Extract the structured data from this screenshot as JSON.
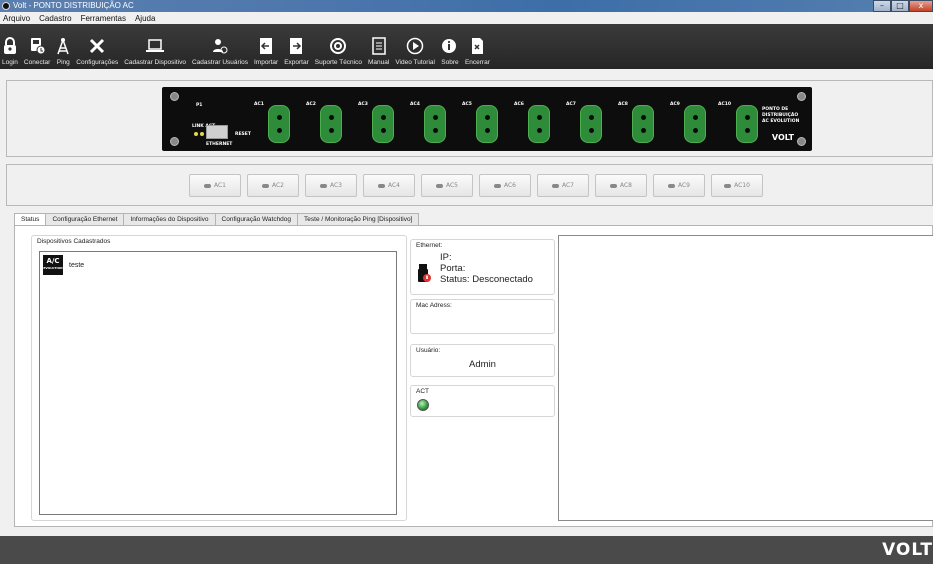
{
  "window": {
    "title": "Volt - PONTO DISTRIBUIÇÃO AC",
    "btn_min": "–",
    "btn_max": "□",
    "btn_close": "x"
  },
  "menu": [
    "Arquivo",
    "Cadastro",
    "Ferramentas",
    "Ajuda"
  ],
  "toolbar": [
    {
      "label": "Login",
      "icon": "lock-icon"
    },
    {
      "label": "Conectar",
      "icon": "connect-icon"
    },
    {
      "label": "Ping",
      "icon": "antenna-icon"
    },
    {
      "label": "Configurações",
      "icon": "tools-icon"
    },
    {
      "label": "Cadastrar Dispositivo",
      "icon": "laptop-icon"
    },
    {
      "label": "Cadastrar Usuários",
      "icon": "add-user-icon"
    },
    {
      "label": "Importar",
      "icon": "import-icon"
    },
    {
      "label": "Exportar",
      "icon": "export-icon"
    },
    {
      "label": "Suporte Técnico",
      "icon": "support-icon"
    },
    {
      "label": "Manual",
      "icon": "manual-icon"
    },
    {
      "label": "Video Tutorial",
      "icon": "play-icon"
    },
    {
      "label": "Sobre",
      "icon": "info-icon"
    },
    {
      "label": "Encerrar",
      "icon": "exit-icon"
    }
  ],
  "board": {
    "port_labels": [
      "AC1",
      "AC2",
      "AC3",
      "AC4",
      "AC5",
      "AC6",
      "AC7",
      "AC8",
      "AC9",
      "AC10"
    ],
    "p1_label": "P1",
    "link_label": "LINK ACT",
    "reset_label": "RESET",
    "ethernet_label": "ETHERNET",
    "brand_lines": [
      "PONTO DE",
      "DISTRIBUIÇÃO",
      "AC EVOLUTION"
    ],
    "logo": "VOLT"
  },
  "ac_buttons": [
    "AC1",
    "AC2",
    "AC3",
    "AC4",
    "AC5",
    "AC6",
    "AC7",
    "AC8",
    "AC9",
    "AC10"
  ],
  "tabs": [
    "Status",
    "Configuração Ethernet",
    "Informações do Dispositivo",
    "Configuração Watchdog",
    "Teste / Monitoração Ping [Dispositivo]"
  ],
  "status": {
    "devices_title": "Dispositivos Cadastrados",
    "devices": [
      {
        "icon_text": "A/C",
        "icon_sub": "EVOLUTION",
        "name": "teste"
      }
    ],
    "ethernet_title": "Ethernet:",
    "ip_label": "IP:",
    "port_label": "Porta:",
    "status_label": "Status: Desconectado",
    "mac_title": "Mac Adress:",
    "user_title": "Usuário:",
    "user_value": "Admin",
    "act_title": "ACT"
  },
  "footer": {
    "logo": "VOLT"
  }
}
